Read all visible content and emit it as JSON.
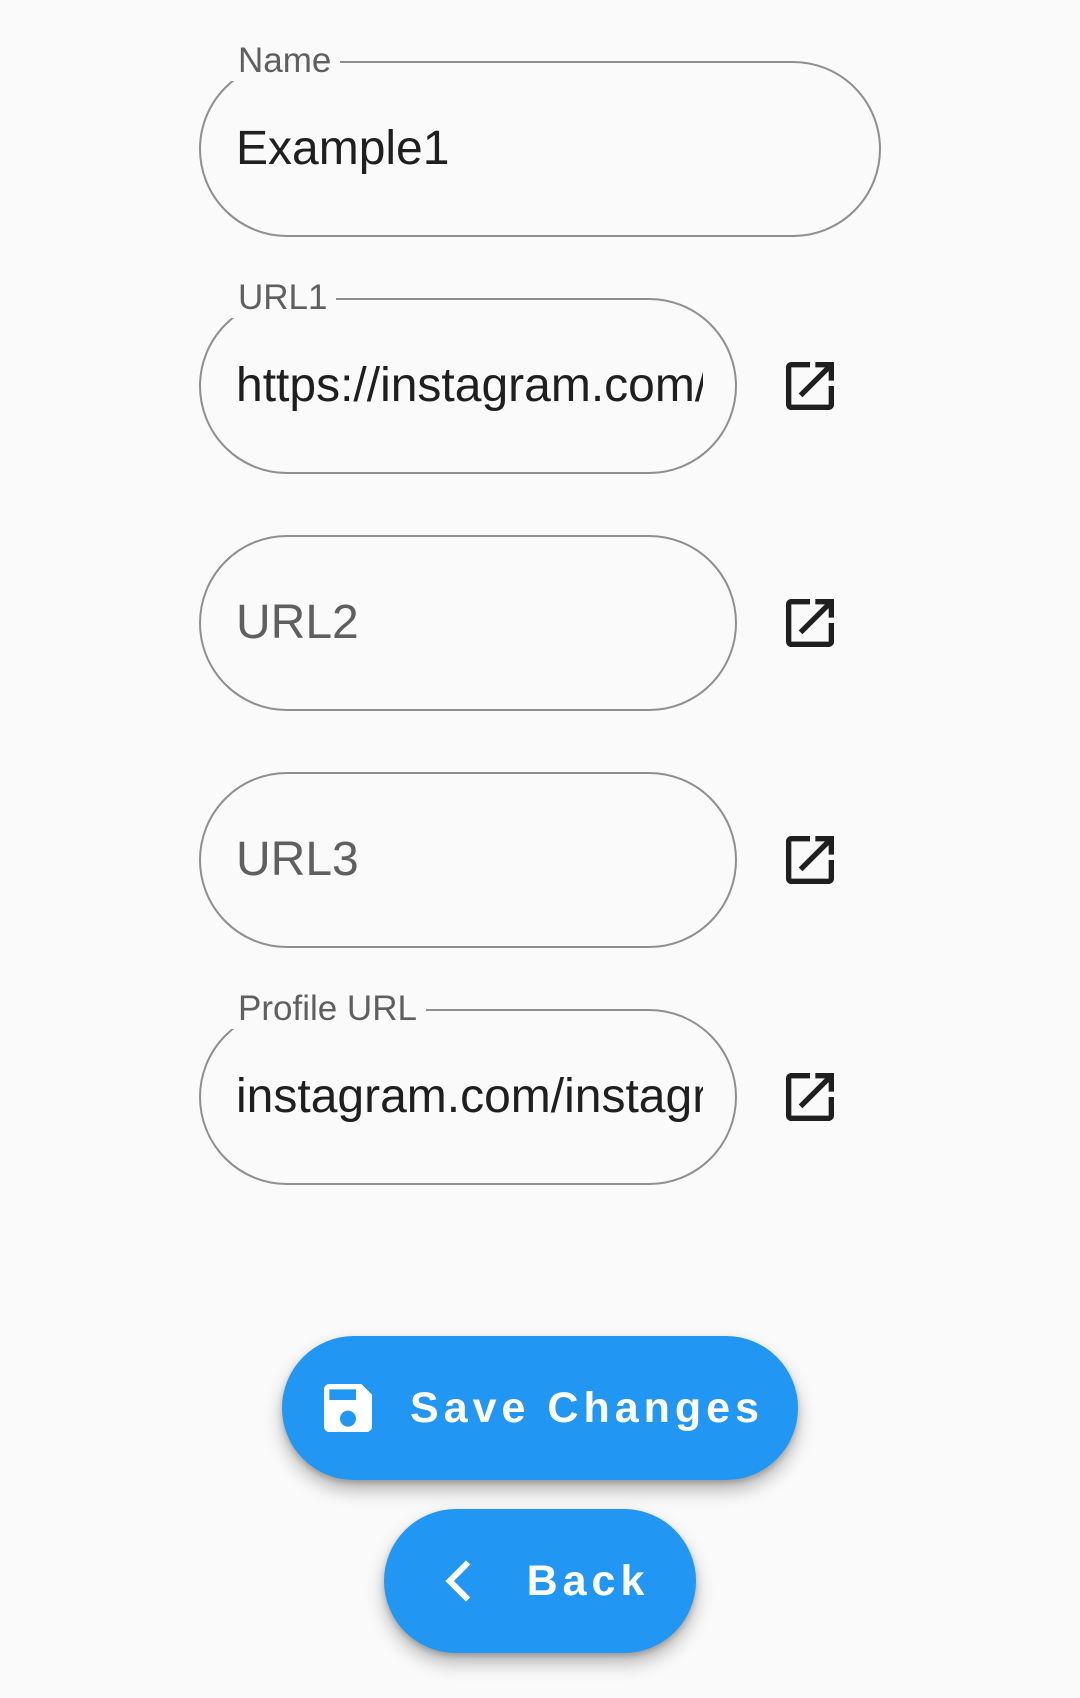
{
  "form": {
    "name": {
      "label": "Name",
      "value": "Example1"
    },
    "url1": {
      "label": "URL1",
      "value": "https://instagram.com/instagram"
    },
    "url2": {
      "placeholder": "URL2"
    },
    "url3": {
      "placeholder": "URL3"
    },
    "profile_url": {
      "label": "Profile URL",
      "value": "instagram.com/instagram"
    }
  },
  "actions": {
    "save_label": "Save Changes",
    "back_label": "Back"
  },
  "icons": {
    "open_link": "open-in-new-icon",
    "save": "floppy-disk-icon",
    "back": "chevron-left-icon"
  },
  "colors": {
    "background": "#fafafa",
    "outline": "#8f8f8f",
    "primary": "#2196f3",
    "label_text": "#5f5f5f",
    "value_text": "#1f1f1f",
    "icon": "#1f1f1f"
  }
}
